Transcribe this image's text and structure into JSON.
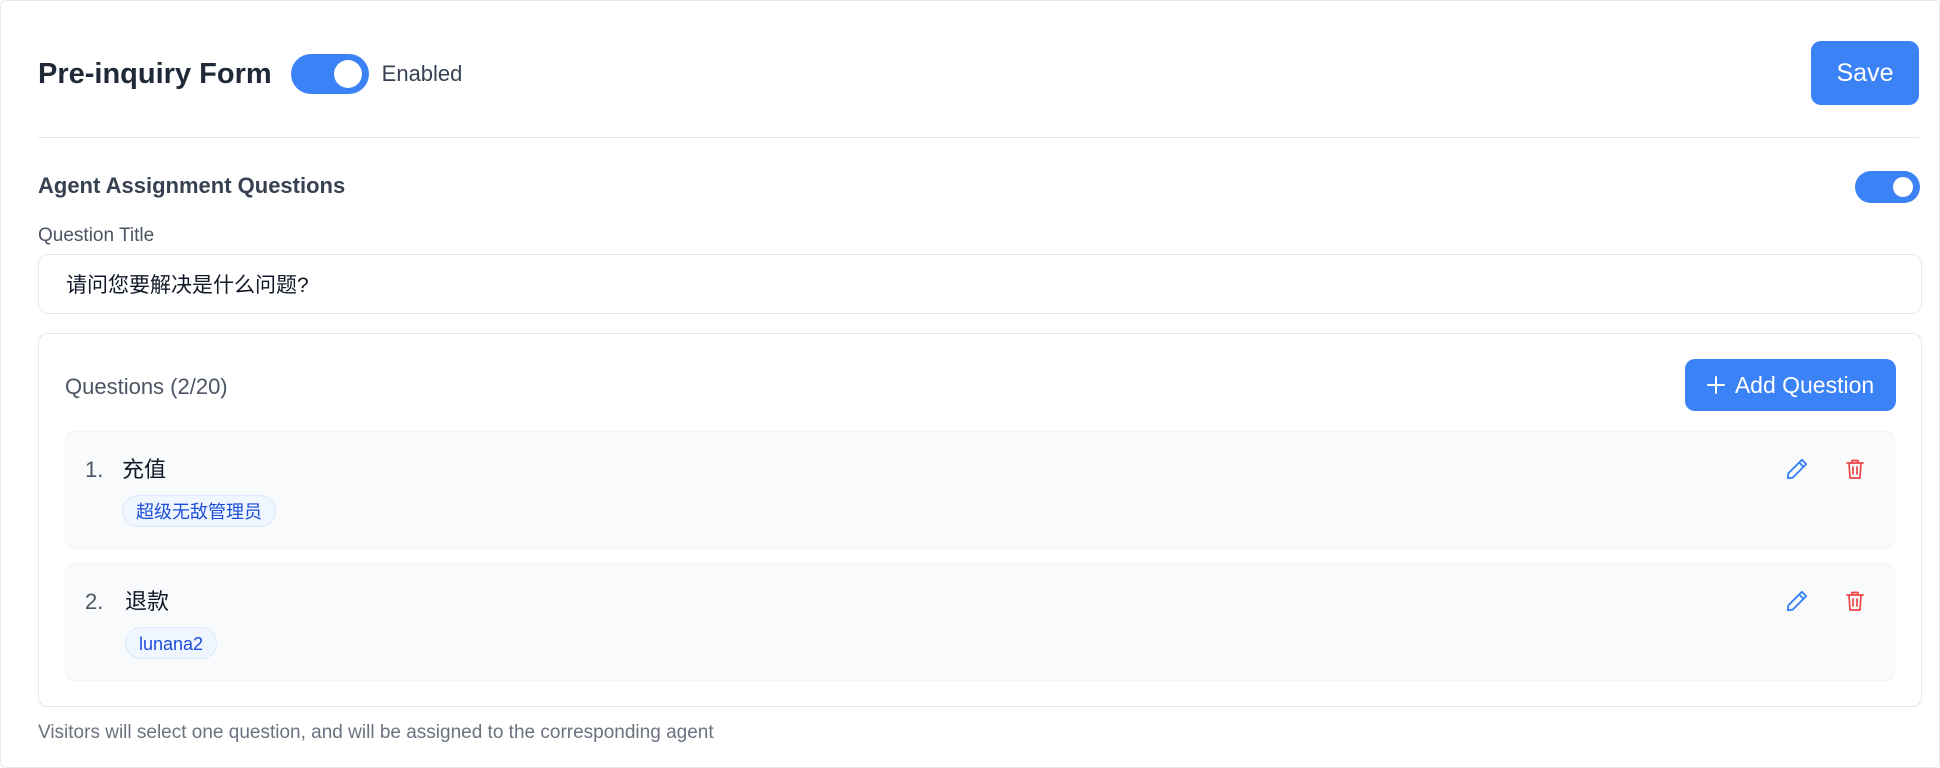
{
  "header": {
    "title": "Pre-inquiry Form",
    "form_toggle_label": "Enabled",
    "save_label": "Save"
  },
  "section": {
    "title": "Agent Assignment Questions",
    "question_title_label": "Question Title",
    "question_title_value": "请问您要解决是什么问题?"
  },
  "questions": {
    "count_label": "Questions (2/20)",
    "add_label": "Add Question",
    "items": [
      {
        "number": "1.",
        "text": "充值",
        "agent": "超级无敌管理员"
      },
      {
        "number": "2.",
        "text": "退款",
        "agent": "lunana2"
      }
    ]
  },
  "footer_note": "Visitors will select one question, and will be assigned to the corresponding agent",
  "colors": {
    "accent": "#3b82f6",
    "danger": "#ef4444",
    "tag_text": "#1d4ed8",
    "tag_bg": "#eff6ff"
  },
  "icons": {
    "edit": "pencil-icon",
    "delete": "trash-icon",
    "add": "plus-icon"
  }
}
